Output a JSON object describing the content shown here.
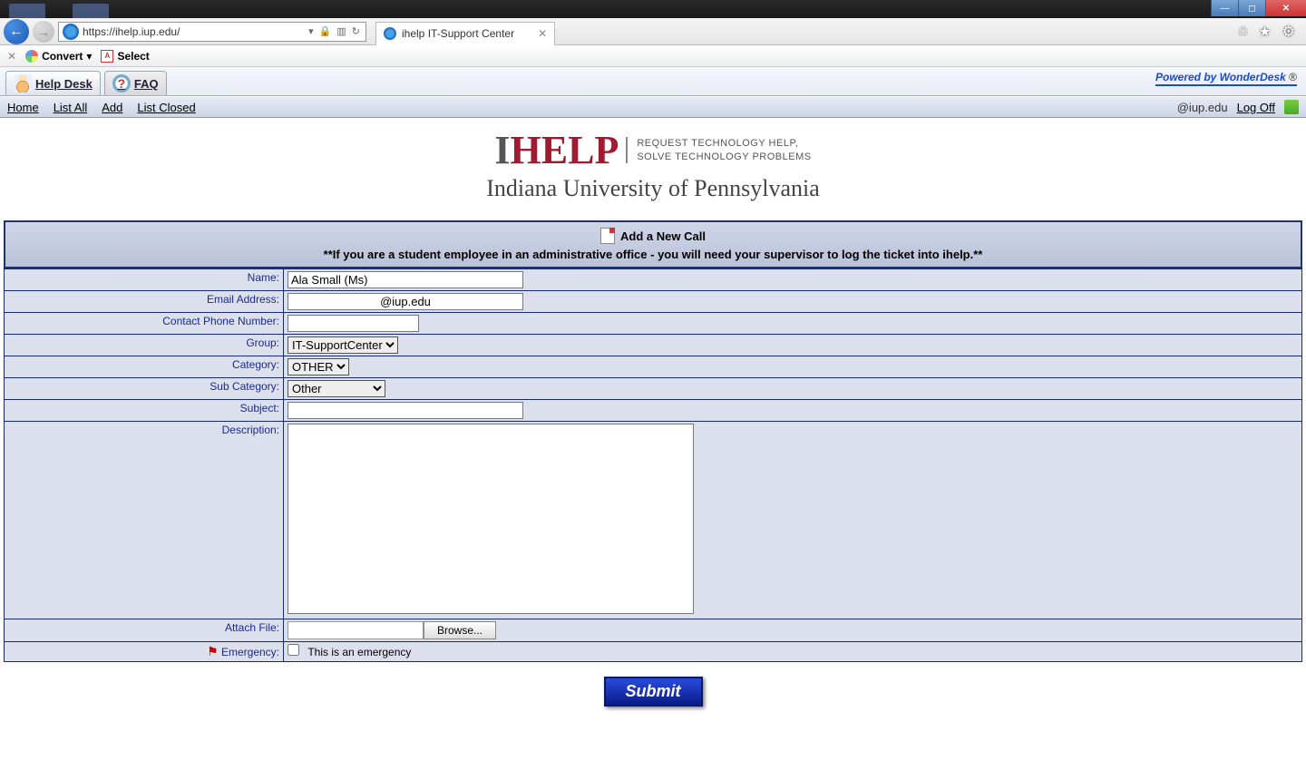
{
  "browser": {
    "url": "https://ihelp.iup.edu/",
    "tab_title": "ihelp IT-Support Center",
    "convert": "Convert",
    "select": "Select"
  },
  "app_tabs": {
    "helpdesk": "Help Desk",
    "faq": "FAQ",
    "powered": "Powered by WonderDesk",
    "reg": "®"
  },
  "subnav": {
    "home": "Home",
    "list_all": "List All",
    "add": "Add",
    "list_closed": "List Closed",
    "user_domain": "@iup.edu",
    "logoff": "Log Off"
  },
  "logo": {
    "i": "I",
    "help": "HELP",
    "tag1": "REQUEST TECHNOLOGY HELP,",
    "tag2": "SOLVE TECHNOLOGY PROBLEMS",
    "university": "Indiana University of Pennsylvania"
  },
  "form": {
    "header_title": "Add a New Call",
    "header_note": "**If you are a student employee in an administrative office - you will need your supervisor to log the ticket into ihelp.**",
    "labels": {
      "name": "Name:",
      "email": "Email Address:",
      "phone": "Contact Phone Number:",
      "group": "Group:",
      "category": "Category:",
      "subcategory": "Sub Category:",
      "subject": "Subject:",
      "description": "Description:",
      "attach": "Attach File:",
      "emergency": "Emergency:"
    },
    "values": {
      "name": "Ala Small (Ms)",
      "email": "@iup.edu",
      "phone": "",
      "group": "IT-SupportCenter",
      "category": "OTHER",
      "subcategory": "Other",
      "subject": "",
      "description": ""
    },
    "browse": "Browse...",
    "emergency_text": "This is an emergency",
    "submit": "Submit"
  }
}
